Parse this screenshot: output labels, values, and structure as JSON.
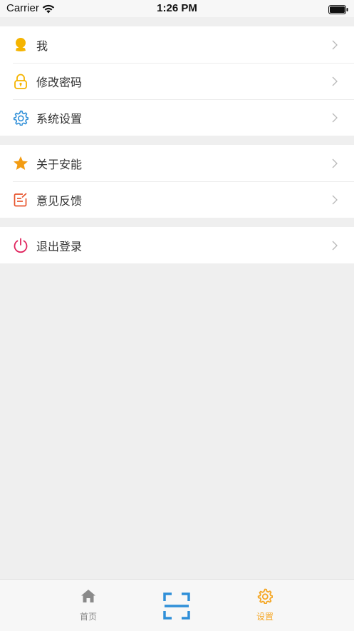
{
  "status_bar": {
    "carrier": "Carrier",
    "time": "1:26 PM"
  },
  "menu_groups": [
    {
      "items": [
        {
          "label": "我",
          "icon": "user-icon",
          "color": "#f5b400"
        },
        {
          "label": "修改密码",
          "icon": "lock-icon",
          "color": "#f5b400"
        },
        {
          "label": "系统设置",
          "icon": "gear-icon",
          "color": "#2f8fd8"
        }
      ]
    },
    {
      "items": [
        {
          "label": "关于安能",
          "icon": "star-icon",
          "color": "#f39c12"
        },
        {
          "label": "意见反馈",
          "icon": "feedback-icon",
          "color": "#e8542c"
        }
      ]
    },
    {
      "items": [
        {
          "label": "退出登录",
          "icon": "power-icon",
          "color": "#e0245e"
        }
      ]
    }
  ],
  "tabbar": {
    "home_label": "首页",
    "settings_label": "设置",
    "inactive_color": "#8a8a8a",
    "active_color": "#f5a623",
    "scan_color": "#2f8fd8"
  }
}
